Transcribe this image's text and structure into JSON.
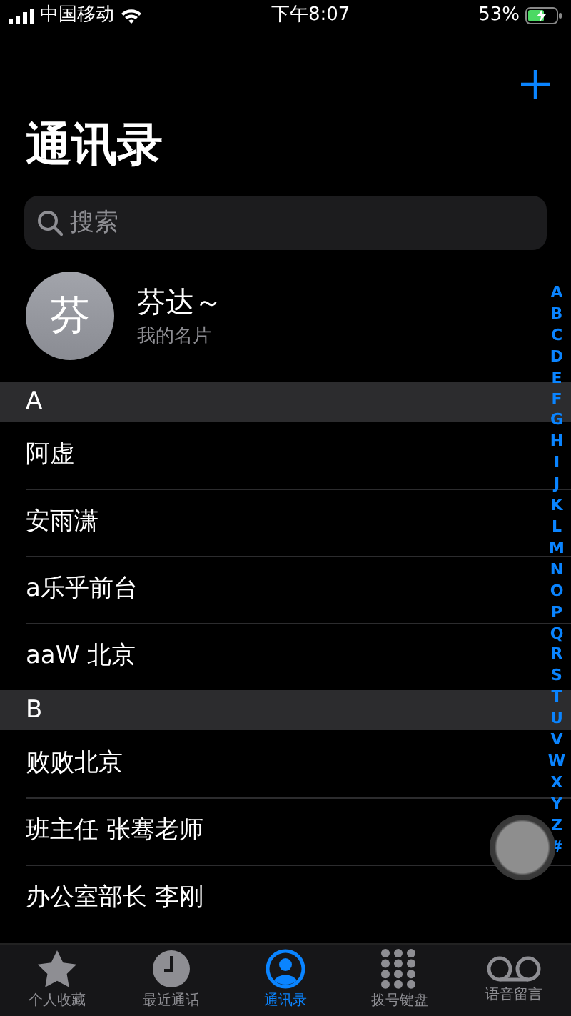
{
  "status_bar": {
    "carrier": "中国移动",
    "time": "下午8:07",
    "battery": "53%"
  },
  "title": "通讯录",
  "search": {
    "placeholder": "搜索"
  },
  "my_card": {
    "initial": "芬",
    "name": "芬达～",
    "subtitle": "我的名片"
  },
  "sections": [
    {
      "letter": "A",
      "contacts": [
        "阿虚",
        "安雨潇",
        "a乐乎前台",
        "aaW 北京"
      ]
    },
    {
      "letter": "B",
      "contacts": [
        "败败北京",
        "班主任 张骞老师",
        "办公室部长 李刚"
      ]
    }
  ],
  "index": [
    "A",
    "B",
    "C",
    "D",
    "E",
    "F",
    "G",
    "H",
    "I",
    "J",
    "K",
    "L",
    "M",
    "N",
    "O",
    "P",
    "Q",
    "R",
    "S",
    "T",
    "U",
    "V",
    "W",
    "X",
    "Y",
    "Z",
    "#"
  ],
  "tabs": [
    {
      "kind": "star",
      "label": "个人收藏",
      "selected": false
    },
    {
      "kind": "clock",
      "label": "最近通话",
      "selected": false
    },
    {
      "kind": "person",
      "label": "通讯录",
      "selected": true
    },
    {
      "kind": "keypad",
      "label": "拨号键盘",
      "selected": false
    },
    {
      "kind": "voicemail",
      "label": "语音留言",
      "selected": false
    }
  ]
}
